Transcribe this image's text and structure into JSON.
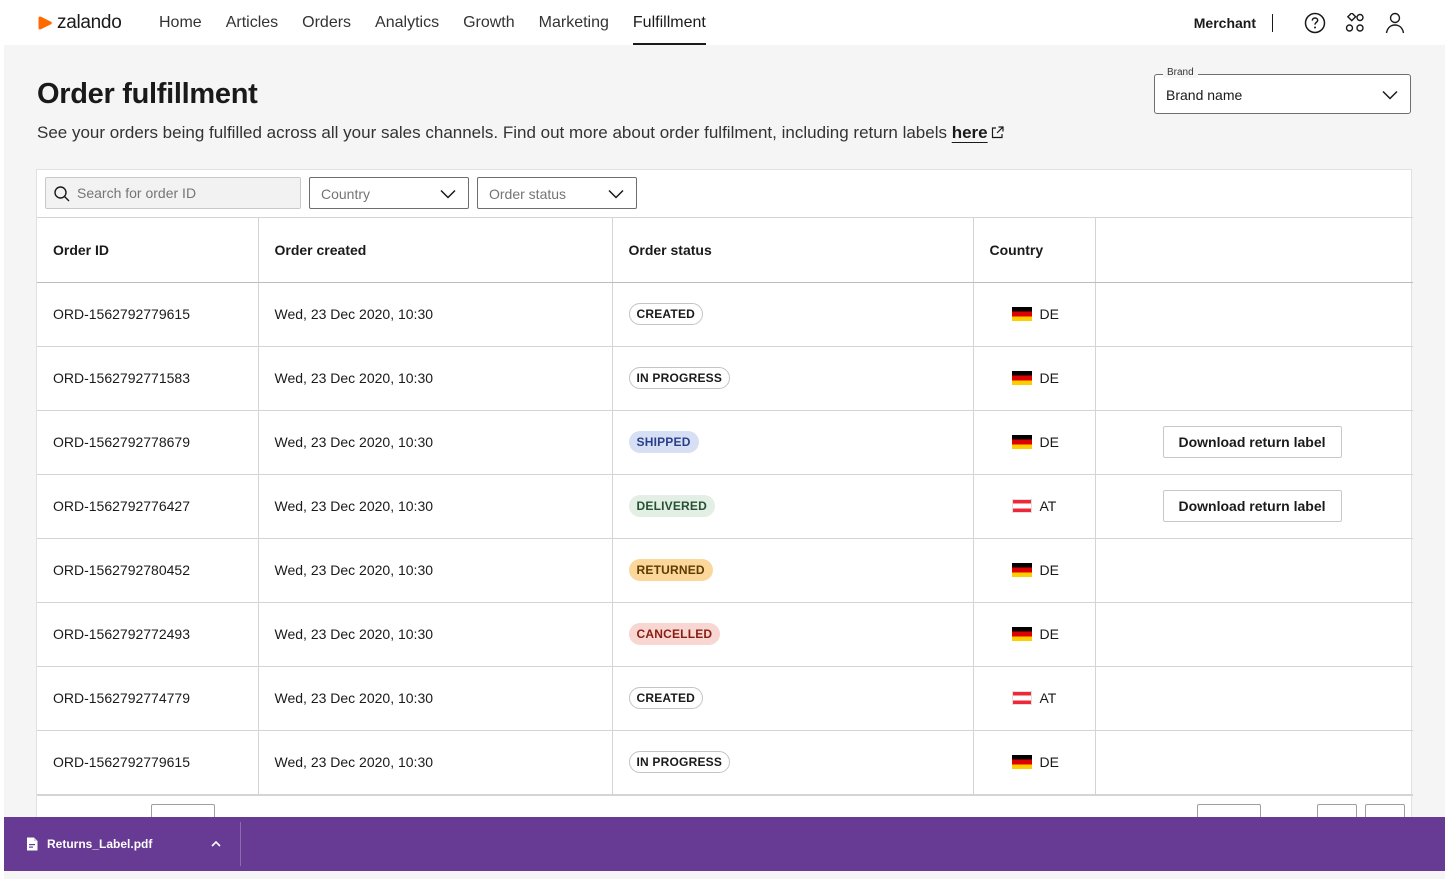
{
  "brand": {
    "logo_text": "zalando",
    "accent": "#ff6900"
  },
  "nav": {
    "items": [
      {
        "label": "Home"
      },
      {
        "label": "Articles"
      },
      {
        "label": "Orders"
      },
      {
        "label": "Analytics"
      },
      {
        "label": "Growth"
      },
      {
        "label": "Marketing"
      },
      {
        "label": "Fulfillment",
        "active": true
      }
    ],
    "account_label": "Merchant",
    "icons": [
      "help-icon",
      "apps-icon",
      "user-icon"
    ]
  },
  "header": {
    "title": "Order fulfillment",
    "subtitle": "See your orders being fulfilled across all your sales channels. Find out more about order fulfilment, including return labels",
    "link_text": "here"
  },
  "brand_select": {
    "legend": "Brand",
    "value": "Brand name"
  },
  "filters": {
    "search_placeholder": "Search for order ID",
    "country_label": "Country",
    "status_label": "Order status"
  },
  "table": {
    "columns": [
      "Order ID",
      "Order created",
      "Order status",
      "Country",
      ""
    ],
    "rows": [
      {
        "id": "ORD-1562792779615",
        "created": "Wed, 23 Dec 2020, 10:30",
        "status": "CREATED",
        "country": "DE",
        "action": ""
      },
      {
        "id": "ORD-1562792771583",
        "created": "Wed, 23 Dec 2020, 10:30",
        "status": "IN PROGRESS",
        "country": "DE",
        "action": ""
      },
      {
        "id": "ORD-1562792778679",
        "created": "Wed, 23 Dec 2020, 10:30",
        "status": "SHIPPED",
        "country": "DE",
        "action": "Download return label"
      },
      {
        "id": "ORD-1562792776427",
        "created": "Wed, 23 Dec 2020, 10:30",
        "status": "DELIVERED",
        "country": "AT",
        "action": "Download return label"
      },
      {
        "id": "ORD-1562792780452",
        "created": "Wed, 23 Dec 2020, 10:30",
        "status": "RETURNED",
        "country": "DE",
        "action": ""
      },
      {
        "id": "ORD-1562792772493",
        "created": "Wed, 23 Dec 2020, 10:30",
        "status": "CANCELLED",
        "country": "DE",
        "action": ""
      },
      {
        "id": "ORD-1562792774779",
        "created": "Wed, 23 Dec 2020, 10:30",
        "status": "CREATED",
        "country": "AT",
        "action": ""
      },
      {
        "id": "ORD-1562792779615",
        "created": "Wed, 23 Dec 2020, 10:30",
        "status": "IN PROGRESS",
        "country": "DE",
        "action": ""
      }
    ]
  },
  "download_bar": {
    "file_name": "Returns_Label.pdf",
    "bar_color": "#673a94"
  }
}
